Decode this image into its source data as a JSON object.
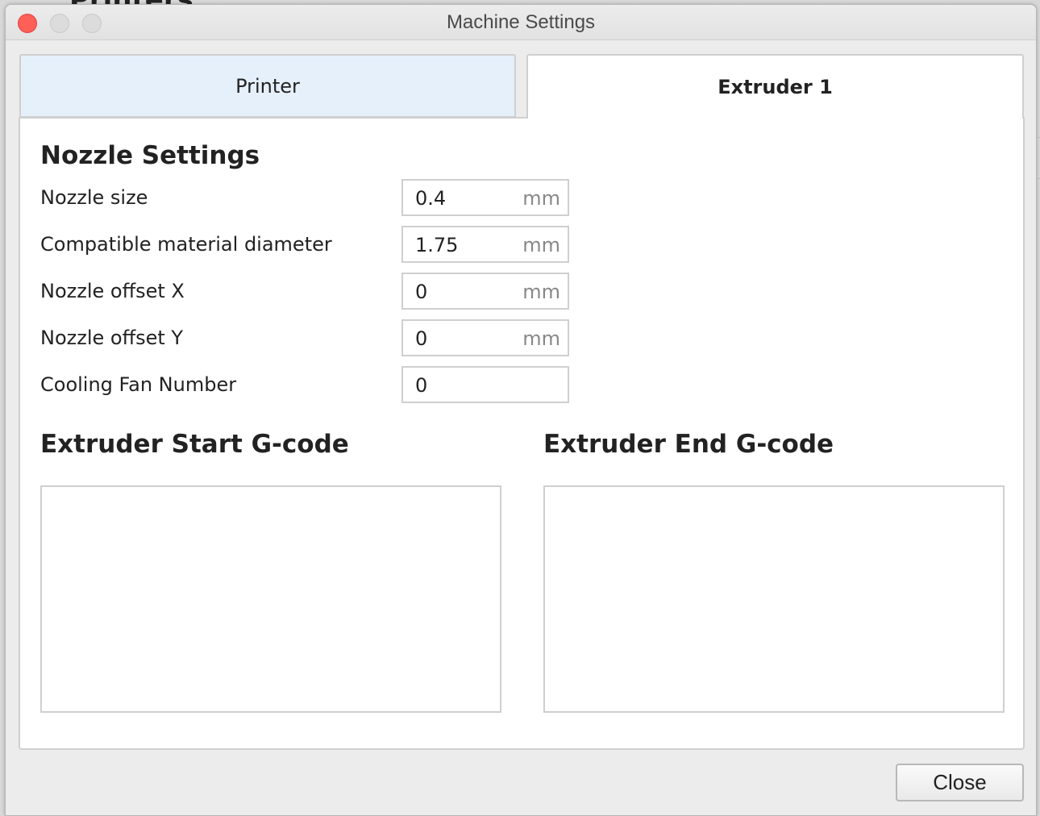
{
  "backdrop": {
    "partial_title": "Printers"
  },
  "window": {
    "title": "Machine Settings"
  },
  "tabs": [
    {
      "label": "Printer",
      "active": false
    },
    {
      "label": "Extruder 1",
      "active": true
    }
  ],
  "nozzle_settings": {
    "title": "Nozzle Settings",
    "fields": [
      {
        "label": "Nozzle size",
        "value": "0.4",
        "unit": "mm"
      },
      {
        "label": "Compatible material diameter",
        "value": "1.75",
        "unit": "mm"
      },
      {
        "label": "Nozzle offset X",
        "value": "0",
        "unit": "mm"
      },
      {
        "label": "Nozzle offset Y",
        "value": "0",
        "unit": "mm"
      },
      {
        "label": "Cooling Fan Number",
        "value": "0",
        "unit": ""
      }
    ]
  },
  "gcode": {
    "start_title": "Extruder Start G-code",
    "start_value": "",
    "end_title": "Extruder End G-code",
    "end_value": ""
  },
  "buttons": {
    "close_label": "Close"
  },
  "colors": {
    "close_traffic_light": "#fe5f57",
    "inactive_tab_bg": "#e6f0fb",
    "panel_bg": "#ffffff",
    "window_bg": "#ececec"
  }
}
